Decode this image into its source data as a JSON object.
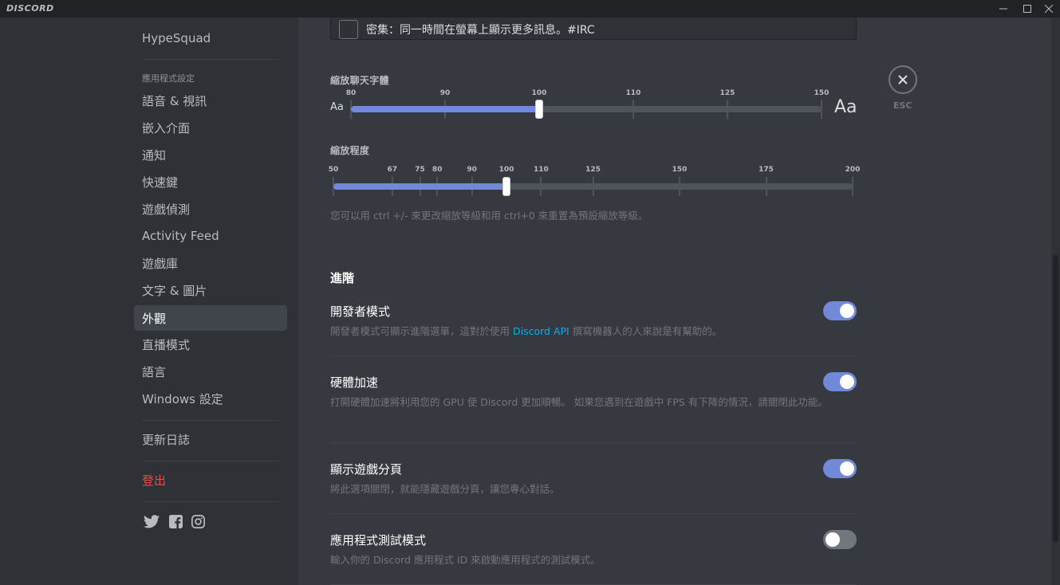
{
  "app": {
    "brand": "DISCORD"
  },
  "sidebar": {
    "items_top": [
      {
        "label": "HypeSquad",
        "name": "sidebar-item-hypesquad"
      }
    ],
    "app_settings_header": "應用程式設定",
    "app_items": [
      {
        "label": "語音 & 視訊",
        "name": "sidebar-item-voice-video"
      },
      {
        "label": "嵌入介面",
        "name": "sidebar-item-overlay"
      },
      {
        "label": "通知",
        "name": "sidebar-item-notifications"
      },
      {
        "label": "快速鍵",
        "name": "sidebar-item-keybinds"
      },
      {
        "label": "遊戲偵測",
        "name": "sidebar-item-game-activity"
      },
      {
        "label": "Activity Feed",
        "name": "sidebar-item-activity-feed"
      },
      {
        "label": "遊戲庫",
        "name": "sidebar-item-game-library"
      },
      {
        "label": "文字 & 圖片",
        "name": "sidebar-item-text-images"
      },
      {
        "label": "外觀",
        "name": "sidebar-item-appearance",
        "active": true
      },
      {
        "label": "直播模式",
        "name": "sidebar-item-streamer-mode"
      },
      {
        "label": "語言",
        "name": "sidebar-item-language"
      },
      {
        "label": "Windows 設定",
        "name": "sidebar-item-windows-settings"
      }
    ],
    "changelog": "更新日誌",
    "logout": "登出",
    "social_icons": [
      "twitter-icon",
      "facebook-icon",
      "instagram-icon"
    ]
  },
  "main": {
    "compact_checkbox_label": "密集：同一時間在螢幕上顯示更多訊息。#IRC",
    "chat_font_scaling": {
      "title": "縮放聊天字體",
      "ticks": [
        80,
        90,
        100,
        110,
        125,
        150
      ],
      "min": 80,
      "max": 150,
      "value": 100,
      "small_preview": "Aa",
      "large_preview": "Aa"
    },
    "zoom_level": {
      "title": "縮放程度",
      "ticks": [
        50,
        67,
        75,
        80,
        90,
        100,
        110,
        125,
        150,
        175,
        200
      ],
      "min": 50,
      "max": 200,
      "value": 100
    },
    "zoom_hint": "您可以用 ctrl +/- 來更改縮放等級和用 ctrl+0 來重置為預設縮放等級。",
    "advanced_title": "進階",
    "options": [
      {
        "title": "開發者模式",
        "desc_before": "開發者模式可顯示進階選單，這對於使用 ",
        "desc_link": "Discord API",
        "desc_after": " 撰寫機器人的人來說是有幫助的。",
        "enabled": true
      },
      {
        "title": "硬體加速",
        "desc": "打開硬體加速將利用您的 GPU 使 Discord 更加順暢。 如果您遇到在遊戲中 FPS 有下降的情況，請關閉此功能。",
        "enabled": true
      },
      {
        "title": "顯示遊戲分頁",
        "desc": "將此選項關閉，就能隱藏遊戲分頁，讓您專心對話。",
        "enabled": true
      },
      {
        "title": "應用程式測試模式",
        "desc": "輸入你的 Discord 應用程式 ID 來啟動應用程式的測試模式。",
        "enabled": false
      }
    ],
    "esc_label": "ESC"
  },
  "colors": {
    "accent": "#7289da",
    "danger": "#f04747",
    "link": "#00b0f4"
  }
}
